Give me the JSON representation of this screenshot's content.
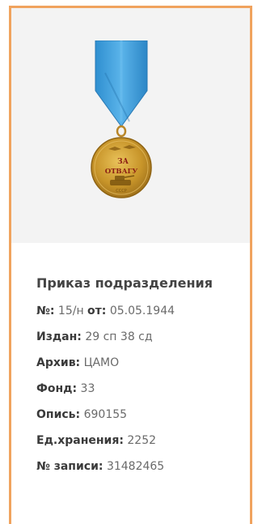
{
  "record": {
    "title": "Приказ подразделения",
    "number_label": "№:",
    "number_value": "15/н",
    "date_label": "от:",
    "date_value": "05.05.1944",
    "issued_label": "Издан:",
    "issued_value": "29 сп 38 сд",
    "archive_label": "Архив:",
    "archive_value": "ЦАМО",
    "fond_label": "Фонд:",
    "fond_value": "33",
    "opis_label": "Опись:",
    "opis_value": "690155",
    "storage_label": "Ед.хранения:",
    "storage_value": "2252",
    "entry_label": "№ записи:",
    "entry_value": "31482465"
  },
  "medal": {
    "icon": "medal-for-courage-icon",
    "ribbon_color": "#4aa6e0",
    "metal_color": "#c8952a",
    "inscription_line1": "ЗА",
    "inscription_line2": "ОТВАГУ"
  },
  "colors": {
    "card_border": "#f0a35e",
    "image_background": "#f3f3f3"
  }
}
